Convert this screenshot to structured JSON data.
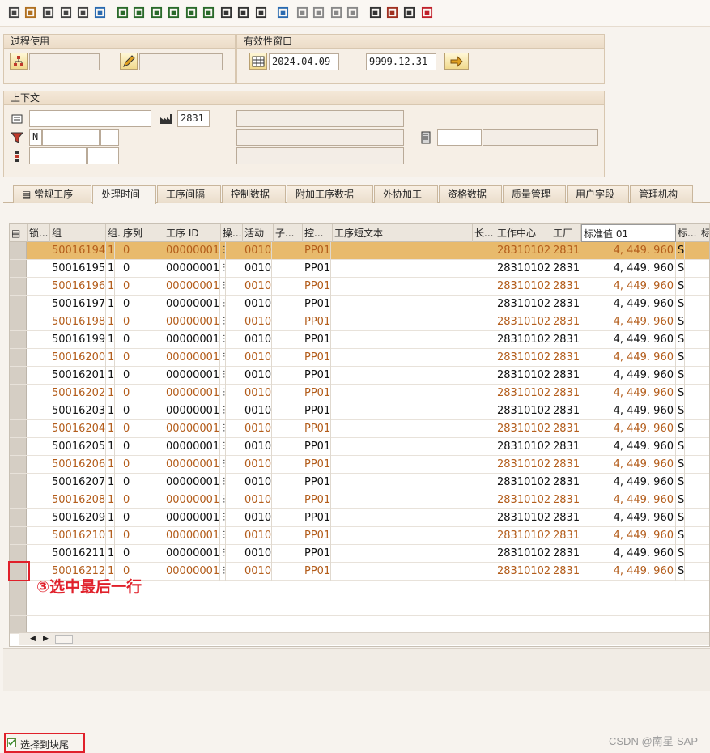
{
  "toolbar": {
    "icons": [
      "new-icon",
      "edit-icon",
      "glasses-icon",
      "copy-icon",
      "delete-icon",
      "find-icon",
      "layout1-icon",
      "layout2-icon",
      "layout3-icon",
      "layout4-icon",
      "layout5-icon",
      "layout6-icon",
      "filter-icon",
      "filter2-icon",
      "columns-icon",
      "find2-icon",
      "first-icon",
      "prev-icon",
      "next-icon",
      "last-icon",
      "hierarchy-icon",
      "print-icon",
      "export-icon",
      "help-icon"
    ]
  },
  "process_box": {
    "title": "过程使用"
  },
  "validity_box": {
    "title": "有效性窗口",
    "date_from": "2024.04.09",
    "date_to": "9999.12.31"
  },
  "context_box": {
    "title": "上下文",
    "plant": "2831",
    "flag": "N"
  },
  "tabs": [
    "常规工序",
    "处理时间",
    "工序间隔",
    "控制数据",
    "附加工序数据",
    "外协加工",
    "资格数据",
    "质量管理",
    "用户字段",
    "管理机构"
  ],
  "active_tab": "处理时间",
  "columns": [
    "锁...",
    "组",
    "组..",
    "序列",
    "工序 ID",
    "操...",
    "活动",
    "子...",
    "控...",
    "工序短文本",
    "长...",
    "工作中心",
    "工厂",
    "标准值 01",
    "标...",
    "标"
  ],
  "rows": [
    [
      "50016194",
      "1",
      "0",
      "00000001",
      "0010",
      "PP01",
      "28310102",
      "2831",
      "4, 449. 960",
      "S"
    ],
    [
      "50016195",
      "1",
      "0",
      "00000001",
      "0010",
      "PP01",
      "28310102",
      "2831",
      "4, 449. 960",
      "S"
    ],
    [
      "50016196",
      "1",
      "0",
      "00000001",
      "0010",
      "PP01",
      "28310102",
      "2831",
      "4, 449. 960",
      "S"
    ],
    [
      "50016197",
      "1",
      "0",
      "00000001",
      "0010",
      "PP01",
      "28310102",
      "2831",
      "4, 449. 960",
      "S"
    ],
    [
      "50016198",
      "1",
      "0",
      "00000001",
      "0010",
      "PP01",
      "28310102",
      "2831",
      "4, 449. 960",
      "S"
    ],
    [
      "50016199",
      "1",
      "0",
      "00000001",
      "0010",
      "PP01",
      "28310102",
      "2831",
      "4, 449. 960",
      "S"
    ],
    [
      "50016200",
      "1",
      "0",
      "00000001",
      "0010",
      "PP01",
      "28310102",
      "2831",
      "4, 449. 960",
      "S"
    ],
    [
      "50016201",
      "1",
      "0",
      "00000001",
      "0010",
      "PP01",
      "28310102",
      "2831",
      "4, 449. 960",
      "S"
    ],
    [
      "50016202",
      "1",
      "0",
      "00000001",
      "0010",
      "PP01",
      "28310102",
      "2831",
      "4, 449. 960",
      "S"
    ],
    [
      "50016203",
      "1",
      "0",
      "00000001",
      "0010",
      "PP01",
      "28310102",
      "2831",
      "4, 449. 960",
      "S"
    ],
    [
      "50016204",
      "1",
      "0",
      "00000001",
      "0010",
      "PP01",
      "28310102",
      "2831",
      "4, 449. 960",
      "S"
    ],
    [
      "50016205",
      "1",
      "0",
      "00000001",
      "0010",
      "PP01",
      "28310102",
      "2831",
      "4, 449. 960",
      "S"
    ],
    [
      "50016206",
      "1",
      "0",
      "00000001",
      "0010",
      "PP01",
      "28310102",
      "2831",
      "4, 449. 960",
      "S"
    ],
    [
      "50016207",
      "1",
      "0",
      "00000001",
      "0010",
      "PP01",
      "28310102",
      "2831",
      "4, 449. 960",
      "S"
    ],
    [
      "50016208",
      "1",
      "0",
      "00000001",
      "0010",
      "PP01",
      "28310102",
      "2831",
      "4, 449. 960",
      "S"
    ],
    [
      "50016209",
      "1",
      "0",
      "00000001",
      "0010",
      "PP01",
      "28310102",
      "2831",
      "4, 449. 960",
      "S"
    ],
    [
      "50016210",
      "1",
      "0",
      "00000001",
      "0010",
      "PP01",
      "28310102",
      "2831",
      "4, 449. 960",
      "S"
    ],
    [
      "50016211",
      "1",
      "0",
      "00000001",
      "0010",
      "PP01",
      "28310102",
      "2831",
      "4, 449. 960",
      "S"
    ],
    [
      "50016212",
      "1",
      "0",
      "00000001",
      "0010",
      "PP01",
      "28310102",
      "2831",
      "4, 449. 960",
      "S"
    ]
  ],
  "annotation": "③选中最后一行",
  "bottom_checkbox": "选择到块尾",
  "watermark": "CSDN @南星-SAP"
}
